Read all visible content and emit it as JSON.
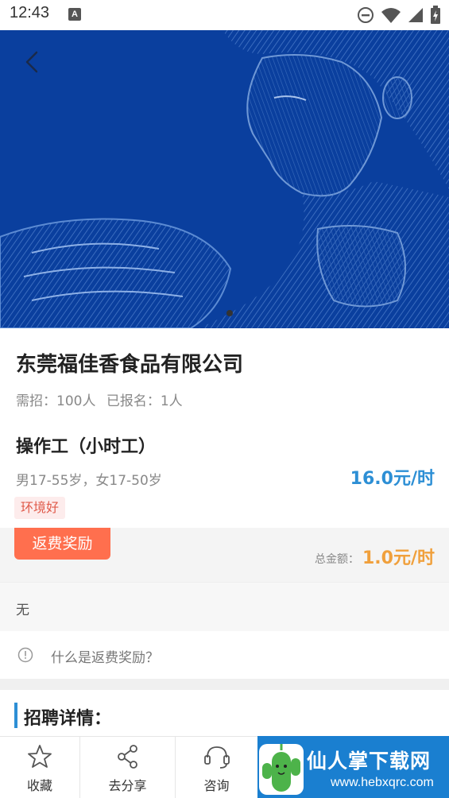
{
  "status_bar": {
    "time": "12:43",
    "notification_letter": "A"
  },
  "banner": {
    "background_color": "#0a3f9e",
    "image_description_icon": "engraved-portrait-image"
  },
  "job": {
    "company_name": "东莞福佳香食品有限公司",
    "needed": "需招：100人",
    "registered": "已报名：1人",
    "title": "操作工（小时工）",
    "age_requirement": "男17-55岁，女17-50岁",
    "wage": "16.0元/时",
    "tag": "环境好"
  },
  "reward": {
    "badge_label": "返费奖励",
    "total_label": "总金额：",
    "total_value": "1.0元/时",
    "detail": "无",
    "faq_text": "什么是返费奖励？"
  },
  "details_section": {
    "title": "招聘详情："
  },
  "bottom_bar": {
    "favorite_label": "收藏",
    "share_label": "去分享",
    "consult_label": "咨询"
  },
  "watermark": {
    "title": "仙人掌下载网",
    "url": "www.hebxqrc.com"
  },
  "colors": {
    "accent_blue": "#2d8fd5",
    "reward_orange": "#ff6f4e",
    "total_orange": "#f0a03c",
    "tag_red": "#e05a4a"
  }
}
